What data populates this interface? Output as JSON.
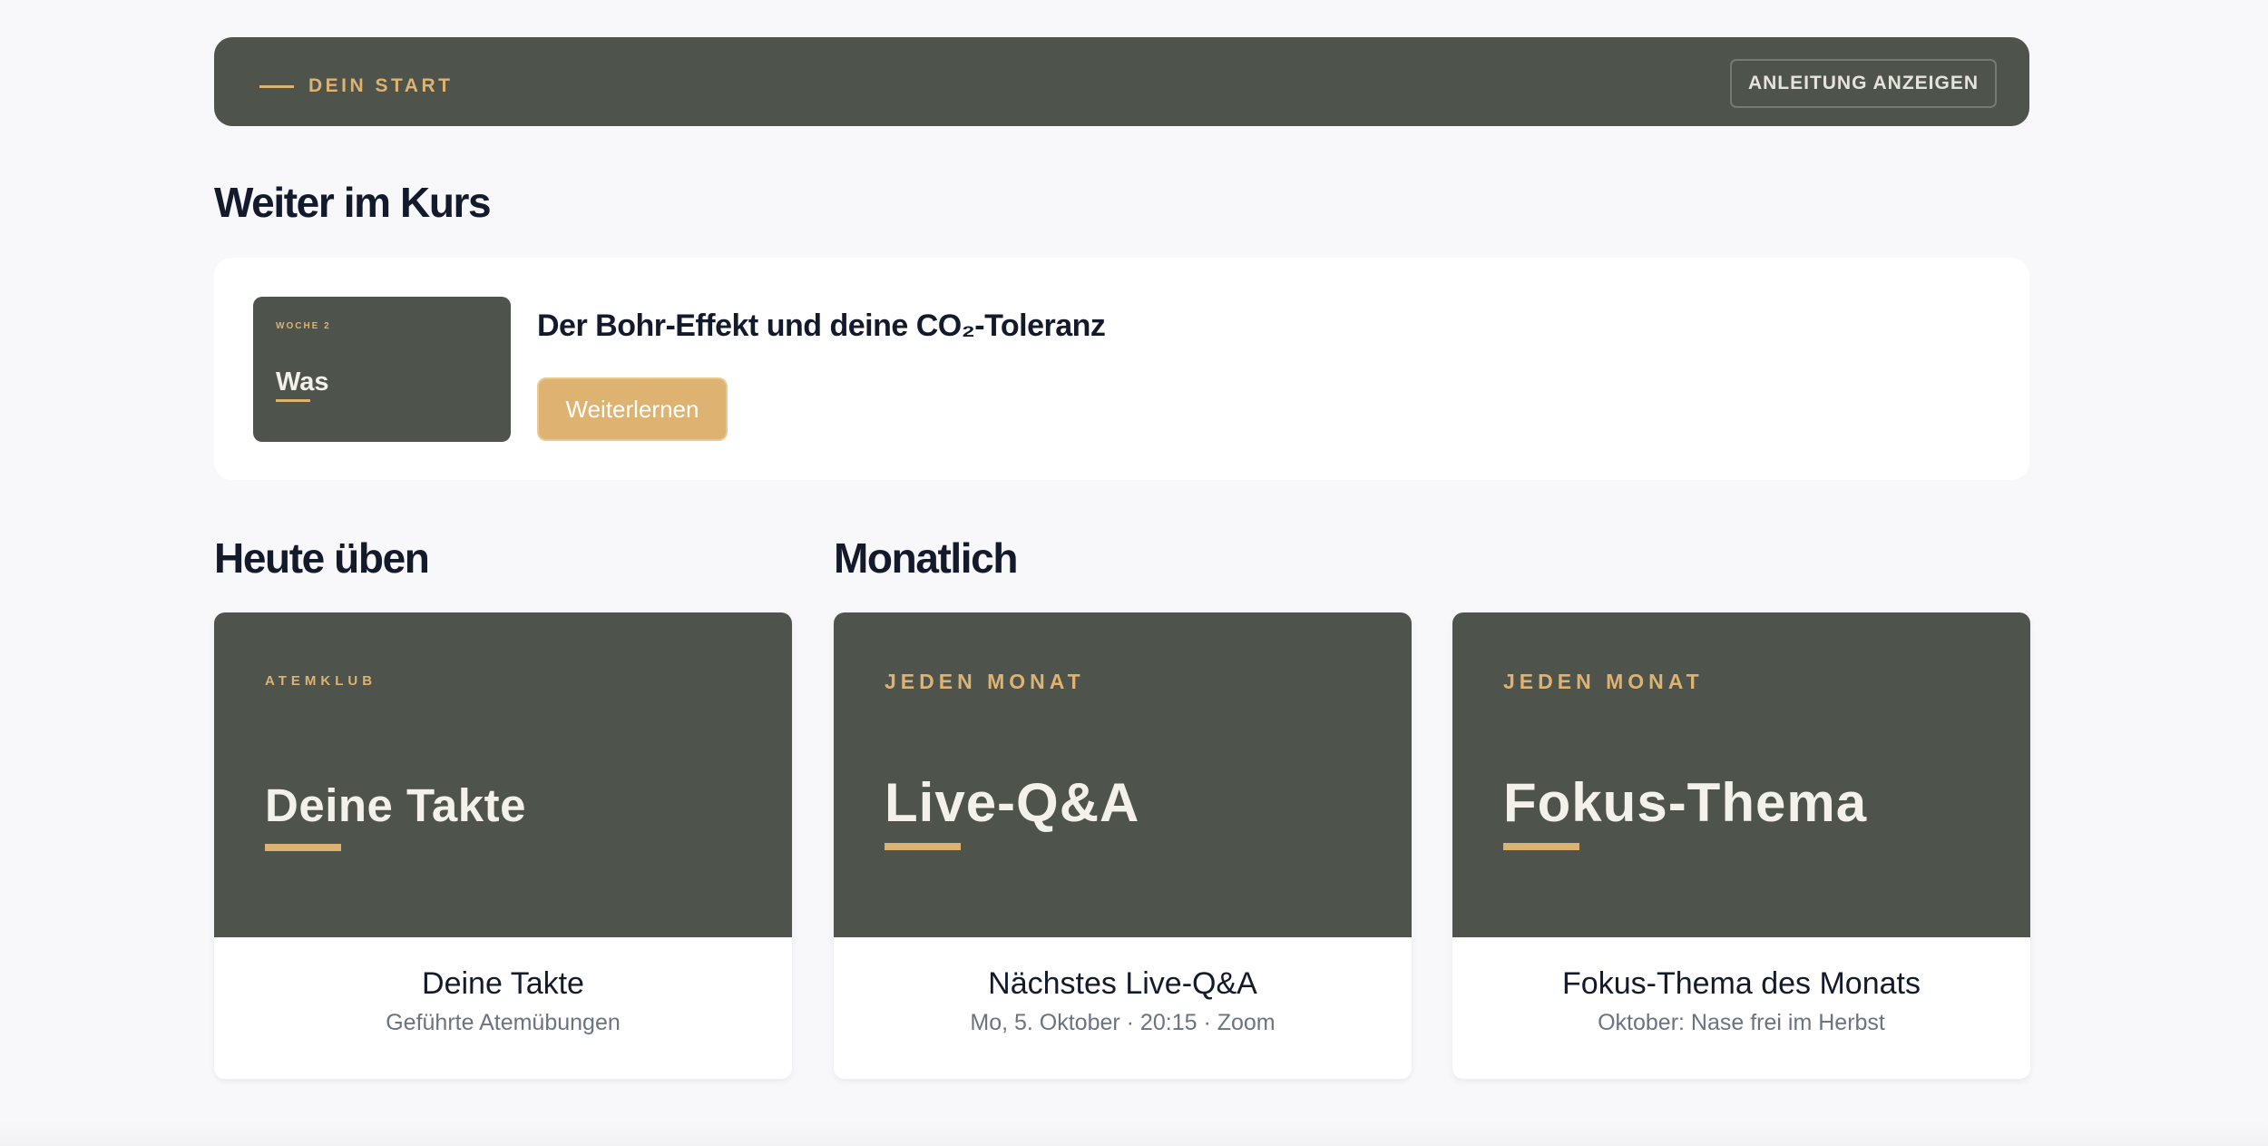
{
  "banner": {
    "label": "DEIN START",
    "button_label": "ANLEITUNG ANZEIGEN"
  },
  "continue_section": {
    "title": "Weiter im Kurs",
    "thumbnail": {
      "week_label": "WOCHE 2",
      "title": "Was"
    },
    "lesson_title": "Der Bohr-Effekt und deine CO₂-Toleranz",
    "button_label": "Weiterlernen"
  },
  "today_section": {
    "title": "Heute üben"
  },
  "monthly_section": {
    "title": "Monatlich"
  },
  "cards": [
    {
      "kicker": "ATEMKLUB",
      "hero_title": "Deine Takte",
      "title": "Deine Takte",
      "subtitle": "Geführte Atemübungen"
    },
    {
      "kicker": "JEDEN MONAT",
      "hero_title": "Live-Q&A",
      "title": "Nächstes Live-Q&A",
      "subtitle": "Mo, 5. Oktober · 20:15 · Zoom"
    },
    {
      "kicker": "JEDEN MONAT",
      "hero_title": "Fokus-Thema",
      "title": "Fokus-Thema des Monats",
      "subtitle": "Oktober: Nase frei im Herbst"
    }
  ],
  "colors": {
    "background": "#f8f8fa",
    "dark_panel": "#4e534b",
    "accent_gold": "#deb271",
    "heading": "#121a2b",
    "muted_text": "#6b7280"
  }
}
